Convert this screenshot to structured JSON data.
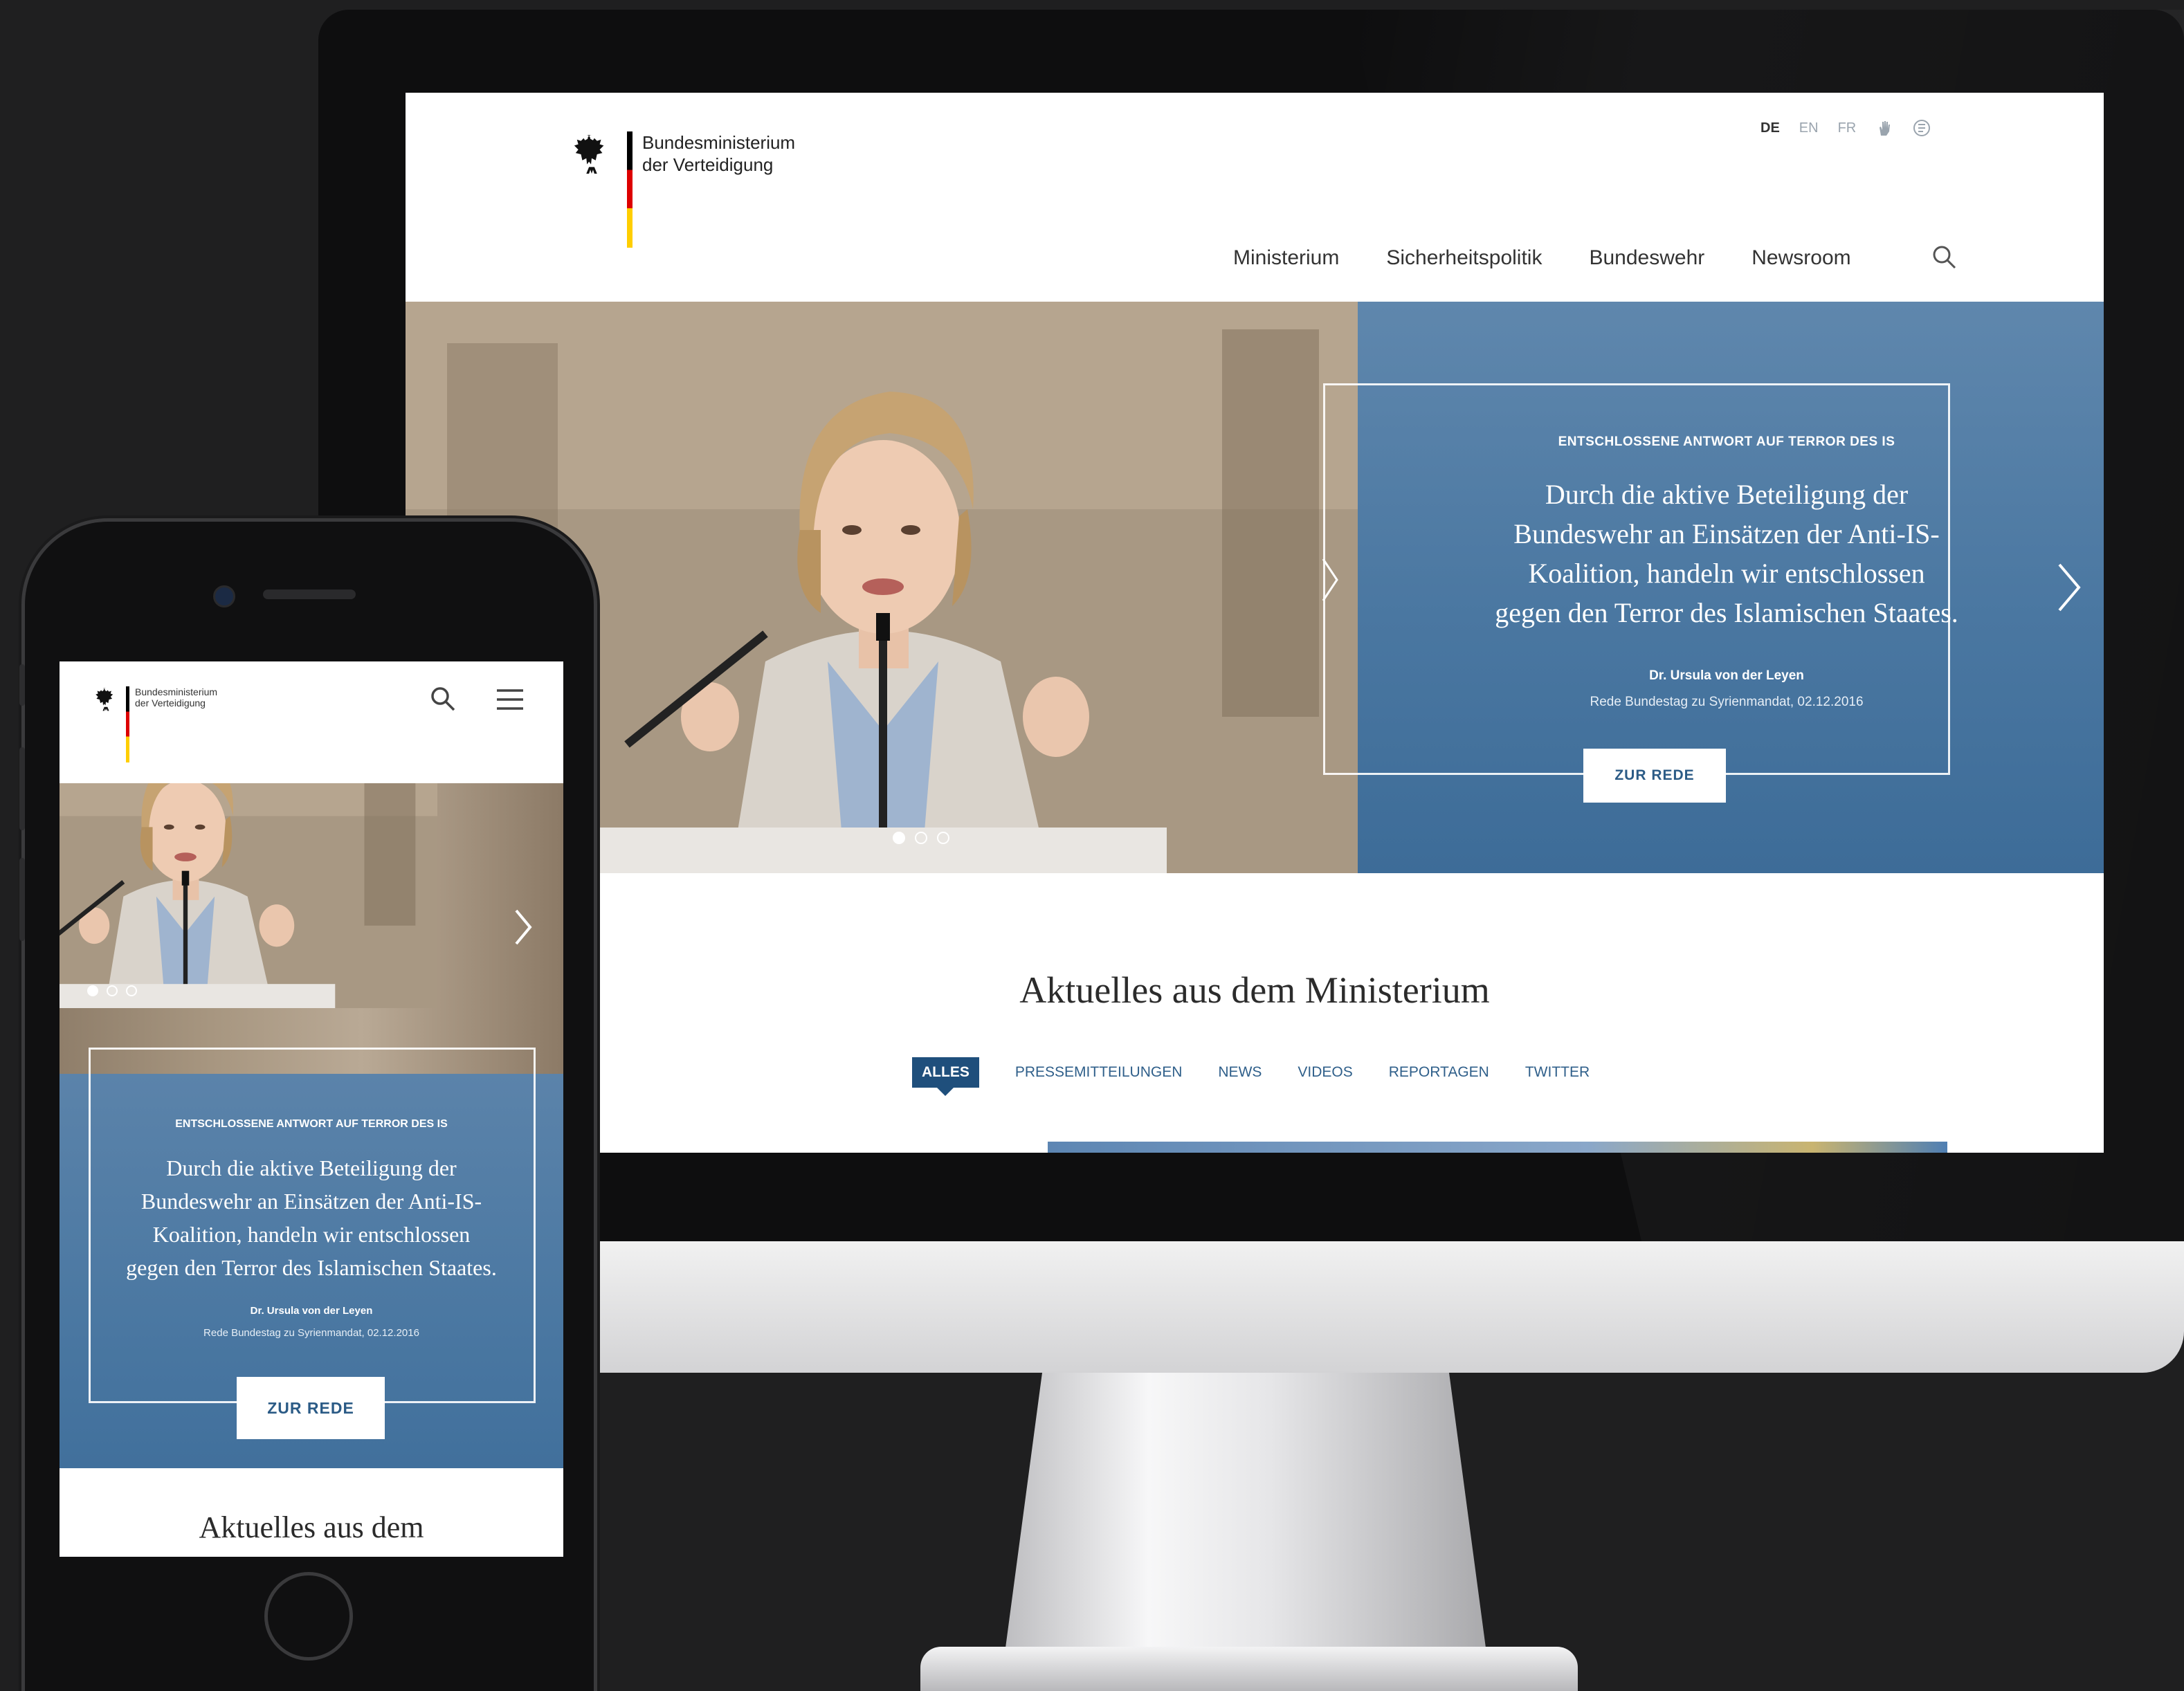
{
  "desktop": {
    "header": {
      "org_line1": "Bundesministerium",
      "org_line2": "der Verteidigung",
      "languages": [
        "DE",
        "EN",
        "FR"
      ],
      "nav": [
        "Ministerium",
        "Sicherheitspolitik",
        "Bundeswehr",
        "Newsroom"
      ]
    },
    "hero": {
      "kicker": "ENTSCHLOSSENE ANTWORT AUF TERROR DES IS",
      "quote_lines": [
        "Durch die aktive Beteiligung  der",
        "Bundeswehr an Einsätzen der Anti-IS-",
        "Koalition, handeln wir entschlossen",
        "gegen den Terror des Islamischen Staates."
      ],
      "author": "Dr. Ursula von der Leyen",
      "source": "Rede Bundestag zu Syrienmandat, 02.12.2016",
      "button": "ZUR REDE",
      "slide_index": 1,
      "slide_count": 3
    },
    "section": {
      "title": "Aktuelles aus dem Ministerium",
      "tabs": [
        "ALLES",
        "PRESSEMITTEILUNGEN",
        "NEWS",
        "VIDEOS",
        "REPORTAGEN",
        "TWITTER"
      ],
      "active_tab": "ALLES"
    }
  },
  "mobile": {
    "header": {
      "org_line1": "Bundesministerium",
      "org_line2": "der Verteidigung"
    },
    "hero": {
      "kicker": "ENTSCHLOSSENE ANTWORT AUF TERROR DES IS",
      "quote_lines": [
        "Durch die aktive Beteiligung  der",
        "Bundeswehr an Einsätzen der Anti-IS-",
        "Koalition, handeln wir entschlossen",
        "gegen den Terror des Islamischen Staates."
      ],
      "author": "Dr. Ursula von der Leyen",
      "source": "Rede Bundestag zu Syrienmandat, 02.12.2016",
      "button": "ZUR REDE"
    },
    "section": {
      "title": "Aktuelles aus dem"
    }
  },
  "colors": {
    "brand_blue": "#1f4f7c",
    "hero_overlay": "#4a77a1",
    "tab_text": "#2f5f8a",
    "device_background": "#1f1f20"
  },
  "icons": [
    "federal-eagle-icon",
    "sign-language-icon",
    "easy-language-icon",
    "search-icon",
    "chevron-right-icon",
    "hamburger-menu-icon"
  ]
}
